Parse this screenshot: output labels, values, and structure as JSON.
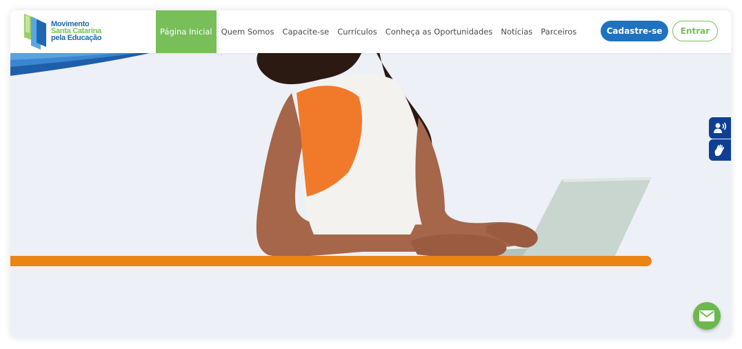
{
  "logo": {
    "line1": "Movimento",
    "line2": "Santa Catarina",
    "line3": "pela Educação"
  },
  "nav": {
    "items": [
      {
        "label": "Página Inicial",
        "active": true
      },
      {
        "label": "Quem Somos"
      },
      {
        "label": "Capacite-se"
      },
      {
        "label": "Currículos"
      },
      {
        "label": "Conheça as Oportunidades"
      },
      {
        "label": "Notícias"
      },
      {
        "label": "Parceiros"
      }
    ]
  },
  "actions": {
    "cadastre": "Cadastre-se",
    "entrar": "Entrar"
  },
  "accessibility": {
    "icons": [
      "audio-reader-icon",
      "sign-language-icon"
    ]
  },
  "contact": {
    "icon": "mail-icon"
  },
  "colors": {
    "brand_blue": "#1f72c1",
    "brand_green": "#78bf5a",
    "accent_orange": "#ea8414",
    "a11y_navy": "#0e3f94",
    "background": "#edf0f6"
  }
}
